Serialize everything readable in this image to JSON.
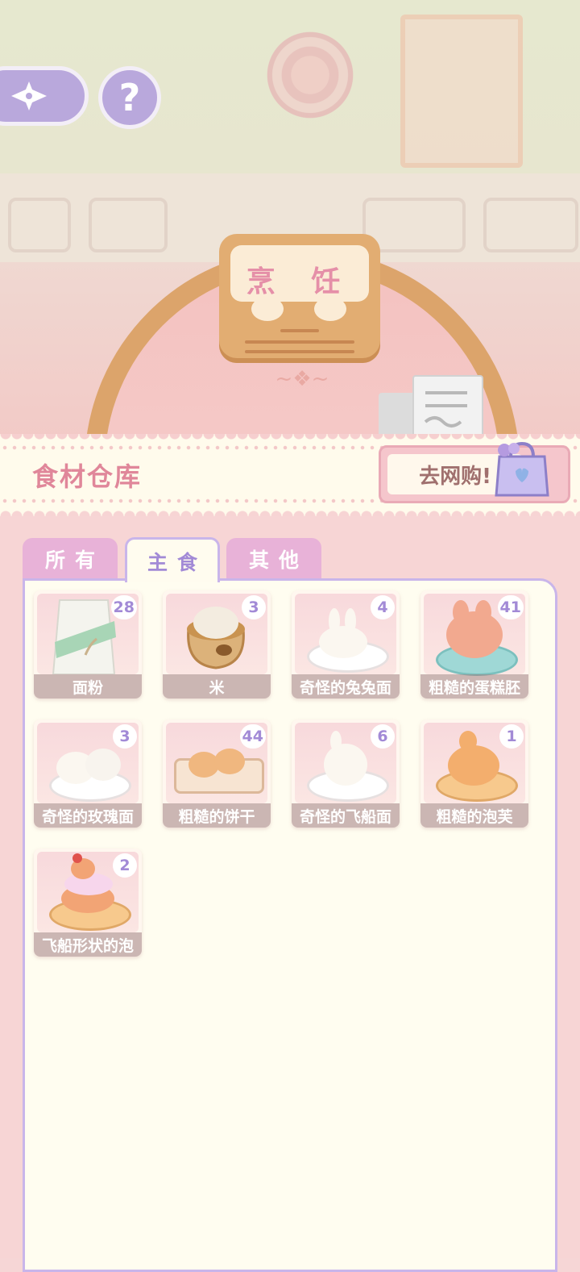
{
  "scene": {
    "sign_text": "烹 饪"
  },
  "top_buttons": {
    "help_label": "?"
  },
  "header": {
    "title": "食材仓库",
    "shop_label": "去网购!"
  },
  "tabs": [
    {
      "label": "所有",
      "active": false
    },
    {
      "label": "主食",
      "active": true
    },
    {
      "label": "其他",
      "active": false
    }
  ],
  "items": [
    {
      "name": "面粉",
      "count": "28",
      "art": "flour-bag"
    },
    {
      "name": "米",
      "count": "3",
      "art": "rice-sack"
    },
    {
      "name": "奇怪的兔兔面",
      "count": "4",
      "art": "bunny-dough-plate"
    },
    {
      "name": "粗糙的蛋糕胚",
      "count": "41",
      "art": "bunny-cake"
    },
    {
      "name": "奇怪的玫瑰面",
      "count": "3",
      "art": "rose-dough-plate"
    },
    {
      "name": "粗糙的饼干",
      "count": "44",
      "art": "biscuit-tray"
    },
    {
      "name": "奇怪的飞船面",
      "count": "6",
      "art": "ship-dough-plate"
    },
    {
      "name": "粗糙的泡芙",
      "count": "1",
      "art": "puff-plate"
    },
    {
      "name": "飞船形状的泡",
      "count": "2",
      "art": "ship-puff-plate"
    }
  ],
  "colors": {
    "accent_purple": "#a28ad6",
    "title_pink": "#e0879a",
    "panel_bg": "#fffdf0"
  }
}
